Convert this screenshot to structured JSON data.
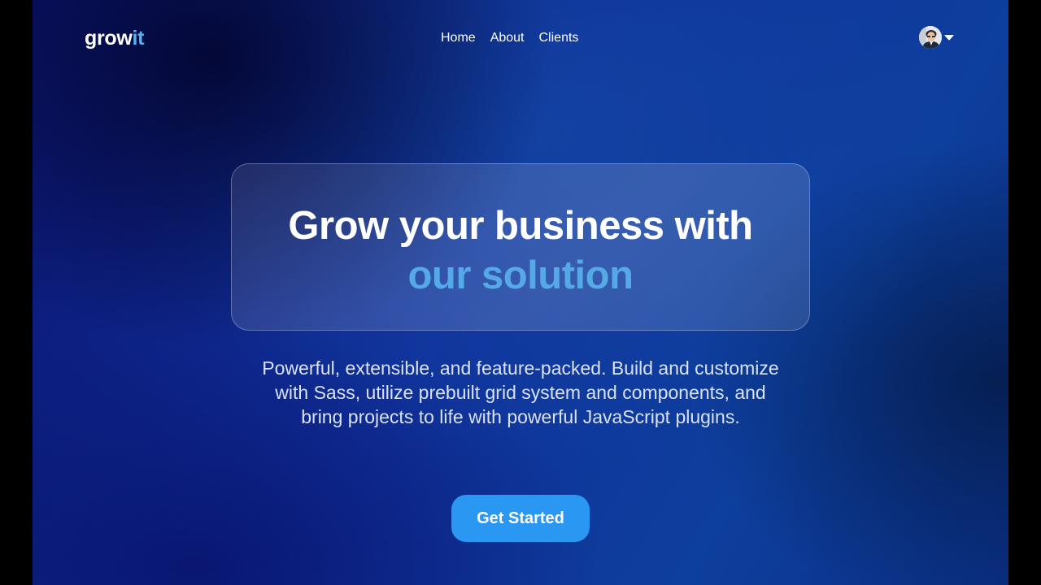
{
  "brand": {
    "name_prefix": "grow",
    "name_accent": "it",
    "accent_color": "#58b0ee"
  },
  "nav": {
    "items": [
      {
        "label": "Home"
      },
      {
        "label": "About"
      },
      {
        "label": "Clients"
      }
    ]
  },
  "user_menu": {
    "avatar_icon": "user-avatar",
    "dropdown_icon": "caret-down-icon"
  },
  "hero": {
    "title_line1": "Grow your business with",
    "title_line2": "our solution",
    "title_accent_color": "#55a9e6",
    "description": "Powerful, extensible, and feature-packed. Build and customize with Sass, utilize prebuilt grid system and components, and bring projects to life with powerful JavaScript plugins.",
    "cta_label": "Get Started",
    "cta_color": "#2a98f3"
  },
  "colors": {
    "background_dark": "#0b1572",
    "background_mid": "#10309a"
  }
}
